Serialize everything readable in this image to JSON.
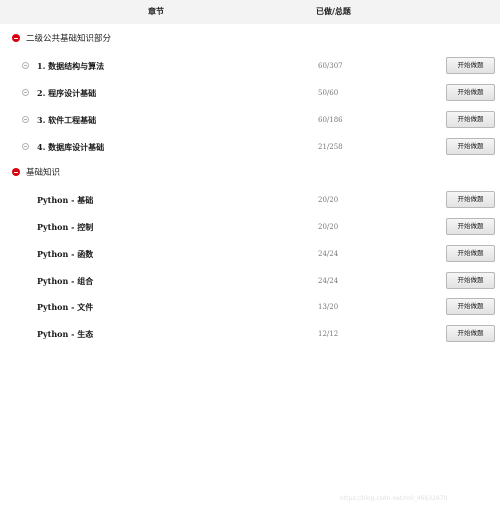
{
  "header": {
    "chapter_label": "章节",
    "progress_label": "已做/总题"
  },
  "sections": [
    {
      "title": "二级公共基础知识部分",
      "rows": [
        {
          "label": "1.  数据结构与算法",
          "count": "60/307",
          "button": "开始做题"
        },
        {
          "label": "2.  程序设计基础",
          "count": "50/60",
          "button": "开始做题"
        },
        {
          "label": "3.  软件工程基础",
          "count": "60/186",
          "button": "开始做题"
        },
        {
          "label": "4.  数据库设计基础",
          "count": "21/258",
          "button": "开始做题"
        }
      ]
    },
    {
      "title": "基础知识",
      "rows": [
        {
          "label": "Python - 基础",
          "count": "20/20",
          "button": "开始做题"
        },
        {
          "label": "Python - 控制",
          "count": "20/20",
          "button": "开始做题"
        },
        {
          "label": "Python - 函数",
          "count": "24/24",
          "button": "开始做题"
        },
        {
          "label": "Python - 组合",
          "count": "24/24",
          "button": "开始做题"
        },
        {
          "label": "Python - 文件",
          "count": "13/20",
          "button": "开始做题"
        },
        {
          "label": "Python - 生态",
          "count": "12/12",
          "button": "开始做题"
        }
      ]
    }
  ],
  "watermark": "https://blog.csdn.net/m0_46632970",
  "colors": {
    "collapse_icon": "#d9000e",
    "header_bg": "#f3f3f3",
    "button_border": "#b8b8b8"
  },
  "icons": {
    "section_toggle": "collapse-minus-icon",
    "row_bullet": "circle-minus-icon"
  }
}
